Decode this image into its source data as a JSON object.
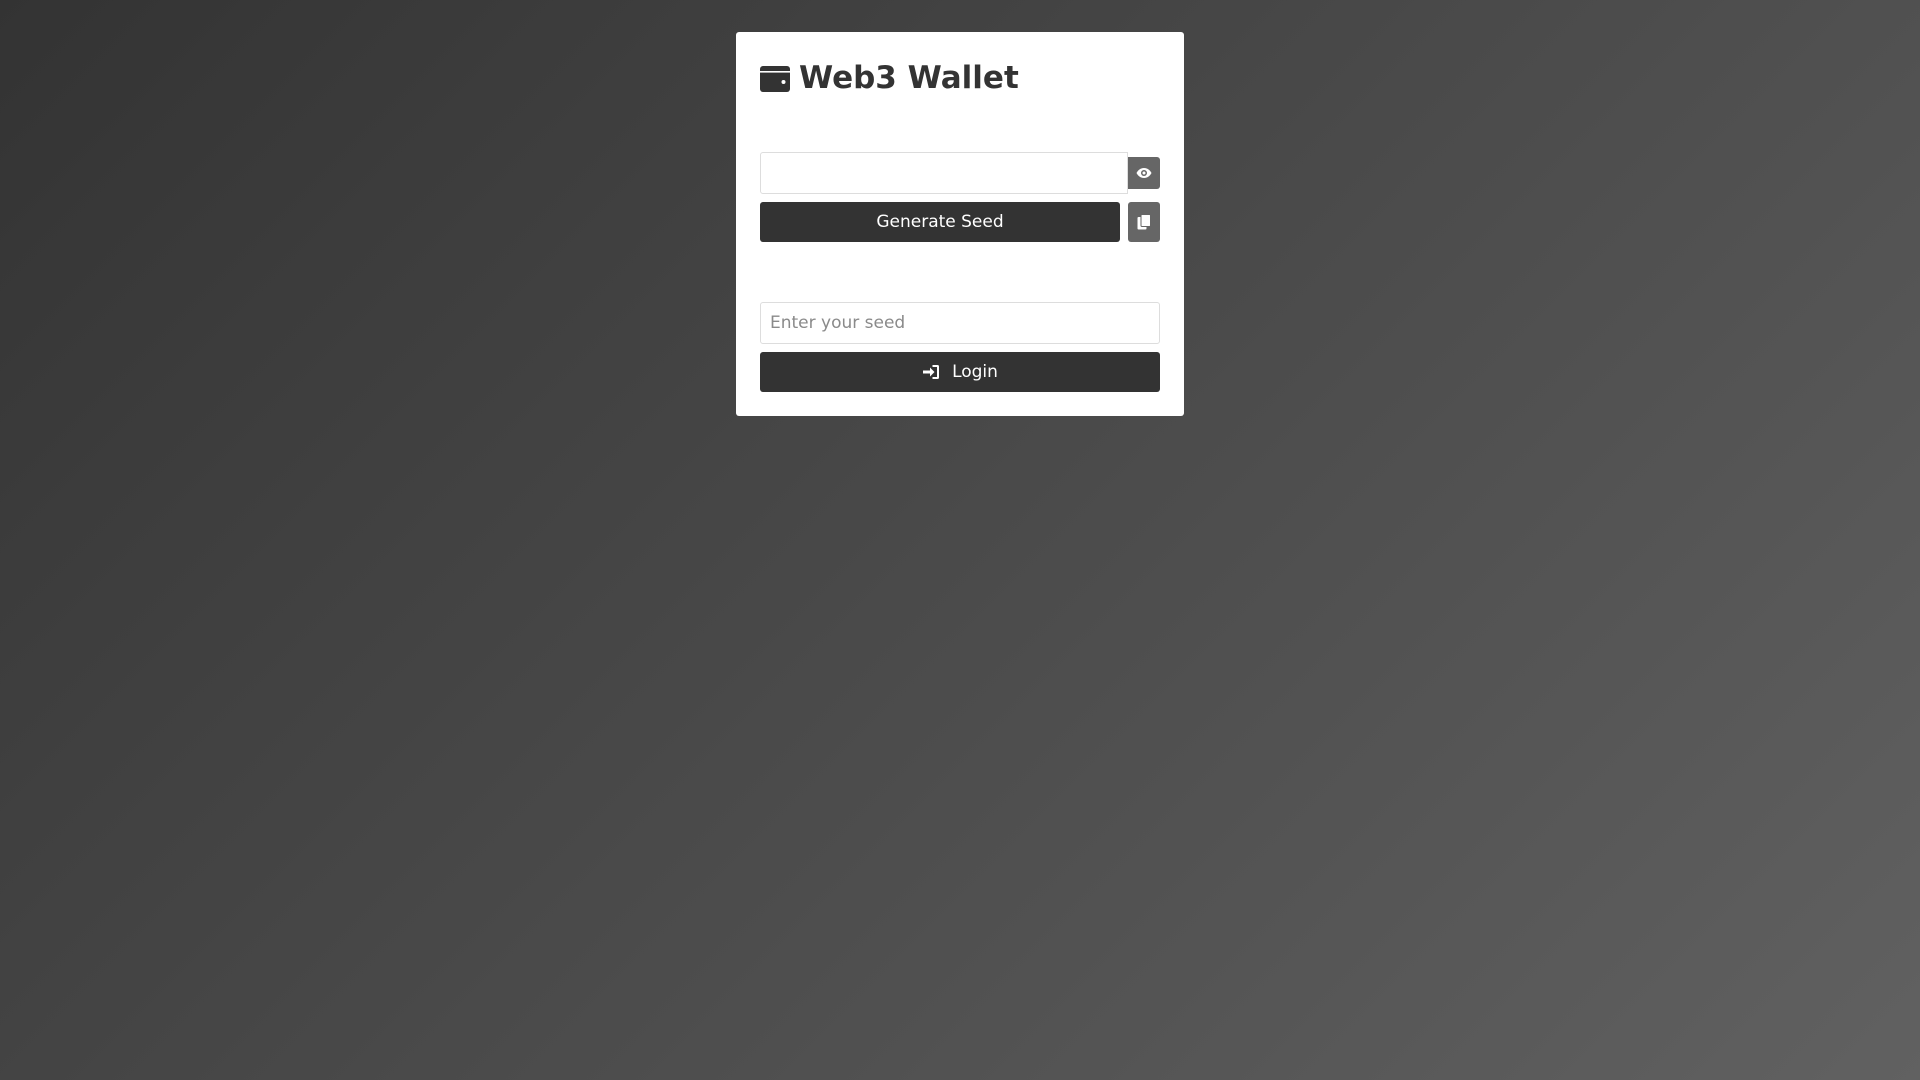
{
  "app": {
    "title": "Web3 Wallet",
    "icon": "wallet-icon"
  },
  "seed_generator": {
    "seed_value": "",
    "toggle_icon": "eye-icon",
    "generate_label": "Generate Seed",
    "copy_icon": "copy-icon"
  },
  "login": {
    "seed_placeholder": "Enter your seed",
    "seed_value": "",
    "button_icon": "login-icon",
    "button_label": "Login"
  },
  "colors": {
    "button_dark": "#333333",
    "icon_button": "#666666",
    "card_background": "#ffffff"
  }
}
